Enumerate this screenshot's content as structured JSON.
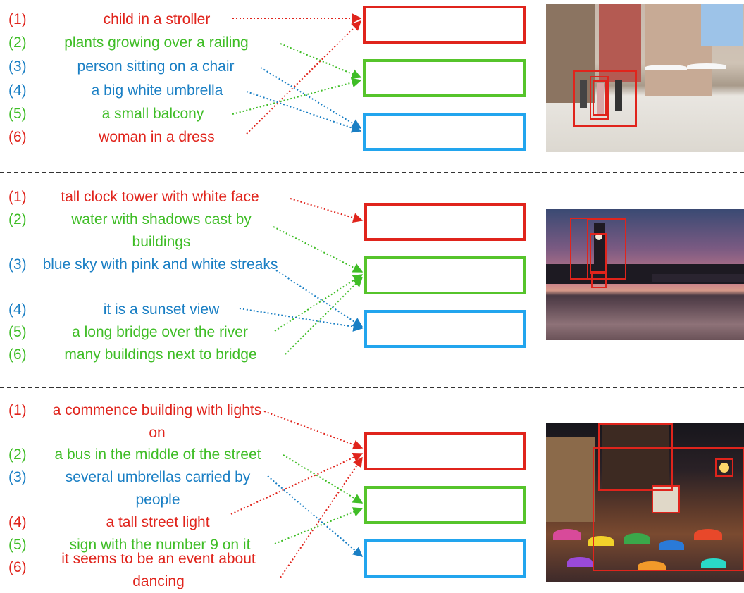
{
  "colors": {
    "red": "#e0241c",
    "green": "#3fbd26",
    "blue": "#1a7fc4",
    "box_blue": "#22a5ee"
  },
  "panels": [
    {
      "phrases": [
        {
          "num": "(1)",
          "text": "child in a stroller",
          "color": "red"
        },
        {
          "num": "(2)",
          "text": "plants growing over a railing",
          "color": "green"
        },
        {
          "num": "(3)",
          "text": "person sitting on a chair",
          "color": "blue"
        },
        {
          "num": "(4)",
          "text": "a big white umbrella",
          "color": "blue"
        },
        {
          "num": "(5)",
          "text": "a small balcony",
          "color": "green"
        },
        {
          "num": "(6)",
          "text": "woman in a dress",
          "color": "red"
        }
      ],
      "boxes": [
        "red",
        "green",
        "blue"
      ],
      "photo": "street-scene-photo"
    },
    {
      "phrases": [
        {
          "num": "(1)",
          "text": "tall clock tower with white face",
          "color": "red"
        },
        {
          "num": "(2)",
          "text": "water with shadows cast by buildings",
          "color": "green"
        },
        {
          "num": "(3)",
          "text": "blue sky with pink and white streaks",
          "color": "blue"
        },
        {
          "num": "(4)",
          "text": "it is a sunset view",
          "color": "blue"
        },
        {
          "num": "(5)",
          "text": "a long bridge over the river",
          "color": "green"
        },
        {
          "num": "(6)",
          "text": "many buildings next to bridge",
          "color": "green"
        }
      ],
      "boxes": [
        "red",
        "green",
        "blue"
      ],
      "photo": "clock-tower-sunset-photo"
    },
    {
      "phrases": [
        {
          "num": "(1)",
          "text": "a commence building with lights on",
          "color": "red"
        },
        {
          "num": "(2)",
          "text": "a bus in the middle of the street",
          "color": "green"
        },
        {
          "num": "(3)",
          "text": "several umbrellas carried by people",
          "color": "blue"
        },
        {
          "num": "(4)",
          "text": "a tall street light",
          "color": "red"
        },
        {
          "num": "(5)",
          "text": "sign with the number 9 on it",
          "color": "green"
        },
        {
          "num": "(6)",
          "text": "it seems to be an event about dancing",
          "color": "red"
        }
      ],
      "boxes": [
        "red",
        "green",
        "blue"
      ],
      "photo": "night-crowd-umbrellas-photo"
    }
  ]
}
